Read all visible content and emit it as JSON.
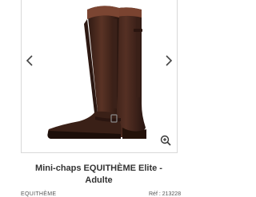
{
  "product": {
    "title_line1": "Mini-chaps EQUITHÈME Elite -",
    "title_line2": "Adulte",
    "brand": "EQUITHÈME",
    "reference": "Réf : 213228"
  },
  "gallery": {
    "prev_icon": "chevron-left-icon",
    "next_icon": "chevron-right-icon",
    "zoom_icon": "zoom-in-icon"
  },
  "colors": {
    "leather": "#4a2a1f",
    "leather_highlight": "#6b3e2c",
    "border": "#d9d9d9",
    "text": "#333333"
  }
}
